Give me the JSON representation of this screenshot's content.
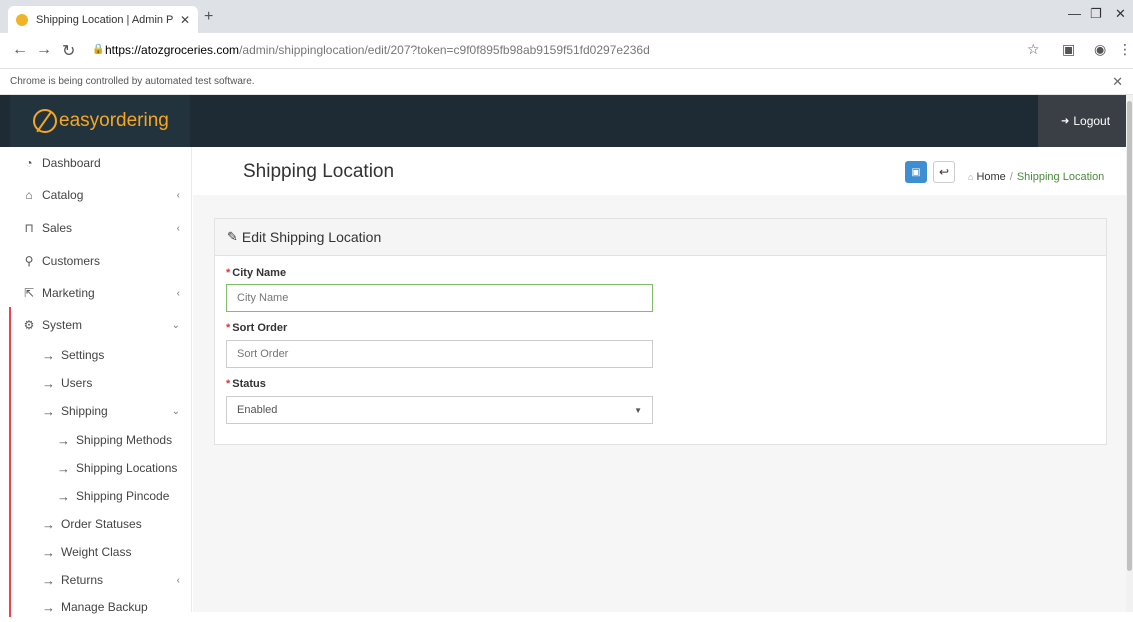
{
  "browser": {
    "tab_title": "Shipping Location | Admin Panel",
    "url_host": "https://atozgroceries.com",
    "url_path": "/admin/shippinglocation/edit/207?token=c9f0f895fb98ab9159f51fd0297e236d",
    "automation_notice": "Chrome is being controlled by automated test software."
  },
  "header": {
    "logo_text": "easyordering",
    "logout_label": "Logout"
  },
  "sidebar": {
    "items": [
      {
        "label": "Dashboard",
        "icon": "dashboard-icon"
      },
      {
        "label": "Catalog",
        "icon": "tag-icon"
      },
      {
        "label": "Sales",
        "icon": "cart-icon"
      },
      {
        "label": "Customers",
        "icon": "user-icon"
      },
      {
        "label": "Marketing",
        "icon": "share-icon"
      },
      {
        "label": "System",
        "icon": "gear-icon"
      }
    ],
    "sub_items": [
      {
        "label": "Settings"
      },
      {
        "label": "Users"
      },
      {
        "label": "Shipping"
      },
      {
        "label": "Shipping Methods"
      },
      {
        "label": "Shipping Locations"
      },
      {
        "label": "Shipping Pincode"
      },
      {
        "label": "Order Statuses"
      },
      {
        "label": "Weight Class"
      },
      {
        "label": "Returns"
      },
      {
        "label": "Manage Backup"
      }
    ]
  },
  "page": {
    "title": "Shipping Location",
    "breadcrumb_home": "Home",
    "breadcrumb_current": "Shipping Location"
  },
  "form": {
    "heading": "Edit Shipping Location",
    "city_label": "City Name",
    "city_placeholder": "City Name",
    "sort_label": "Sort Order",
    "sort_placeholder": "Sort Order",
    "status_label": "Status",
    "status_value": "Enabled"
  },
  "colors": {
    "header_bg": "#1e2b35",
    "logo_accent": "#f5a623",
    "save_button": "#3d8fd1",
    "breadcrumb_active": "#4a8a3c",
    "required_marker": "#dd3333",
    "active_bar": "#e8434f"
  }
}
